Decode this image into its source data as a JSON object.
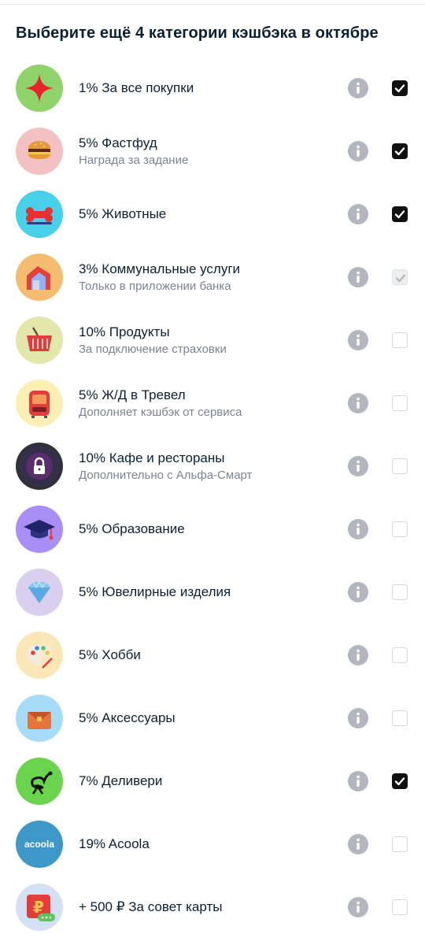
{
  "header": {
    "title": "Выберите ещё 4 категории кэшбэка в октябре"
  },
  "colors": {
    "checkbox_on": "#111111",
    "checkbox_off_border": "#d5d8dc",
    "info_icon": "#b3b7bd",
    "text_primary": "#0b1f35",
    "text_secondary": "#7b8391"
  },
  "categories": [
    {
      "label": "1% За все покупки",
      "sub": "",
      "icon": "red-star-icon",
      "bg": "#8fd36b",
      "state": "checked"
    },
    {
      "label": "5% Фастфуд",
      "sub": "Награда за задание",
      "icon": "burger-icon",
      "bg": "#f4c1c3",
      "state": "checked"
    },
    {
      "label": "5% Животные",
      "sub": "",
      "icon": "bone-icon",
      "bg": "#47d0e8",
      "state": "checked"
    },
    {
      "label": "3% Коммунальные услуги",
      "sub": "Только в приложении банка",
      "icon": "house-icon",
      "bg": "#f5bc6f",
      "state": "disabled-checked"
    },
    {
      "label": "10% Продукты",
      "sub": "За подключение страховки",
      "icon": "basket-icon",
      "bg": "#e3e7a9",
      "state": "unchecked"
    },
    {
      "label": "5% Ж/Д в Тревел",
      "sub": "Дополняет кэшбэк от сервиса",
      "icon": "train-icon",
      "bg": "#fbefb6",
      "state": "unchecked"
    },
    {
      "label": "10% Кафе и рестораны",
      "sub": "Дополнительно с Альфа-Смарт",
      "icon": "lock-icon",
      "bg": "#2f3336",
      "state": "unchecked"
    },
    {
      "label": "5% Образование",
      "sub": "",
      "icon": "graduation-cap-icon",
      "bg": "#a98ff5",
      "state": "unchecked"
    },
    {
      "label": "5% Ювелирные изделия",
      "sub": "",
      "icon": "diamond-icon",
      "bg": "#d9cfee",
      "state": "unchecked"
    },
    {
      "label": "5% Хобби",
      "sub": "",
      "icon": "palette-icon",
      "bg": "#fbe7b5",
      "state": "unchecked"
    },
    {
      "label": "5% Аксессуары",
      "sub": "",
      "icon": "bag-icon",
      "bg": "#a6dcf7",
      "state": "unchecked"
    },
    {
      "label": "7% Деливери",
      "sub": "",
      "icon": "ostrich-icon",
      "bg": "#6bd44e",
      "state": "checked"
    },
    {
      "label": "19% Acoola",
      "sub": "",
      "icon": "acoola-logo",
      "logo_text": "acoola",
      "bg": "#3d97c8",
      "state": "unchecked"
    },
    {
      "label": "+ 500 ₽ За совет карты",
      "sub": "",
      "icon": "ruble-card-icon",
      "bg": "#d6e0f5",
      "state": "unchecked"
    }
  ]
}
